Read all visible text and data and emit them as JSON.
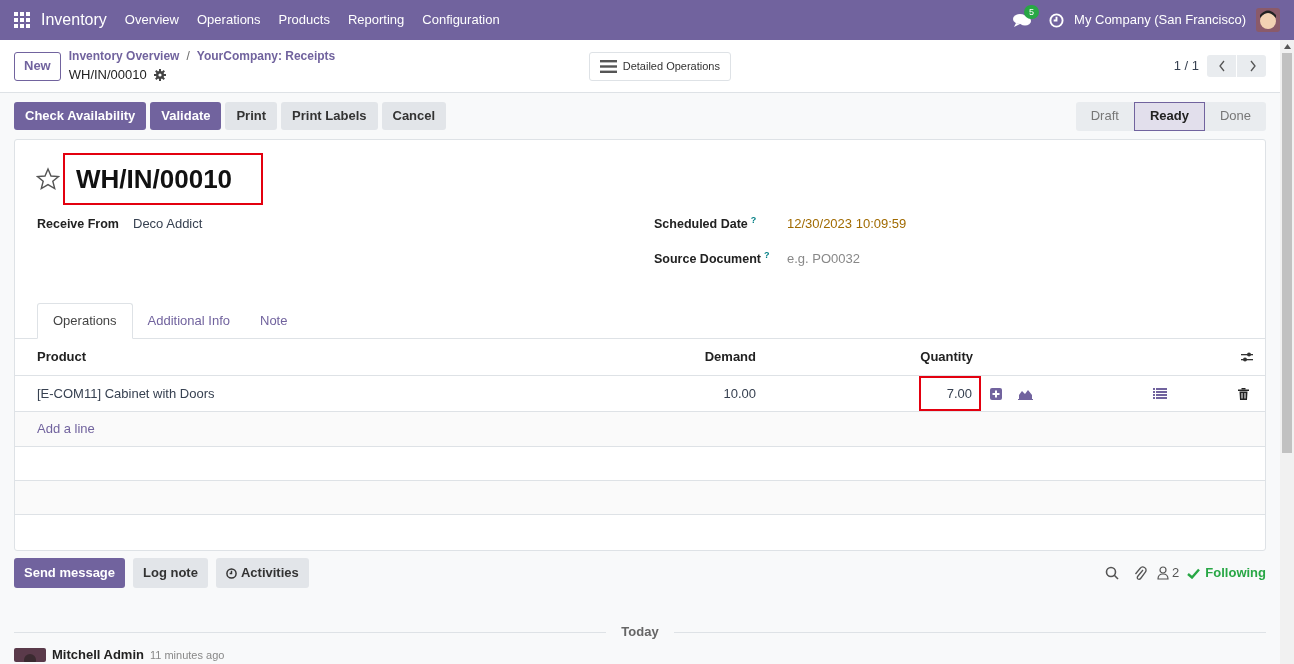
{
  "navbar": {
    "app": "Inventory",
    "menu": [
      "Overview",
      "Operations",
      "Products",
      "Reporting",
      "Configuration"
    ],
    "message_count": "5",
    "company": "My Company (San Francisco)"
  },
  "control_panel": {
    "new_button": "New",
    "breadcrumbs": [
      "Inventory Overview",
      "YourCompany: Receipts"
    ],
    "breadcrumb_separator": "/",
    "record": "WH/IN/00010",
    "view_button": "Detailed Operations",
    "pager": "1 / 1"
  },
  "actions": [
    {
      "label": "Check Availability",
      "primary": true
    },
    {
      "label": "Validate",
      "primary": true
    },
    {
      "label": "Print",
      "primary": false
    },
    {
      "label": "Print Labels",
      "primary": false
    },
    {
      "label": "Cancel",
      "primary": false
    }
  ],
  "statusbar": [
    {
      "label": "Draft",
      "selected": false
    },
    {
      "label": "Ready",
      "selected": true
    },
    {
      "label": "Done",
      "selected": false
    }
  ],
  "form": {
    "favorite": false,
    "title": "WH/IN/00010",
    "title_highlighted": true,
    "left_fields": [
      {
        "label": "Receive From",
        "value": "Deco Addict"
      }
    ],
    "right_fields": [
      {
        "label": "Scheduled Date",
        "help": "?",
        "value": "12/30/2023 10:09:59"
      },
      {
        "label": "Source Document",
        "help": "?",
        "placeholder": "e.g. PO0032"
      }
    ]
  },
  "tabs": [
    {
      "label": "Operations",
      "selected": true
    },
    {
      "label": "Additional Info",
      "selected": false
    },
    {
      "label": "Note",
      "selected": false
    }
  ],
  "table": {
    "columns": [
      "Product",
      "Demand",
      "Quantity"
    ],
    "rows": [
      {
        "product": "[E-COM11] Cabinet with Doors",
        "demand": "10.00",
        "quantity": "7.00",
        "quantity_highlighted": true
      }
    ],
    "add_line": "Add a line"
  },
  "chatter": {
    "buttons": [
      {
        "label": "Send message",
        "primary": true,
        "kind": "plain"
      },
      {
        "label": "Log note",
        "primary": false,
        "kind": "plain"
      },
      {
        "label": "Activities",
        "primary": false,
        "kind": "clock"
      }
    ],
    "followers": "2",
    "following": "Following",
    "divider": "Today",
    "message": {
      "author": "Mitchell Admin",
      "time": "11 minutes ago"
    }
  }
}
